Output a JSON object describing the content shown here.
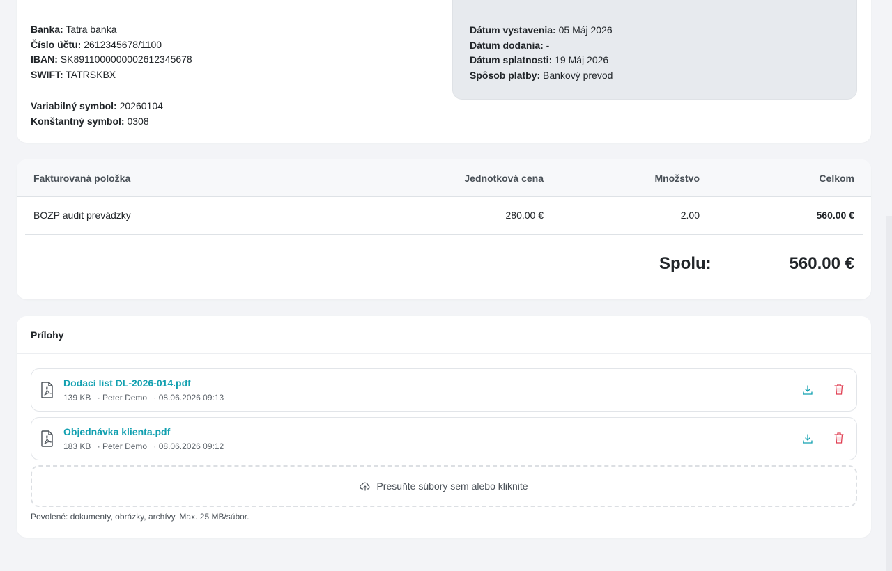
{
  "payment": {
    "bank_label": "Banka:",
    "bank_value": "Tatra banka",
    "account_label": "Číslo účtu:",
    "account_value": "2612345678/1100",
    "iban_label": "IBAN:",
    "iban_value": "SK8911000000002612345678",
    "swift_label": "SWIFT:",
    "swift_value": "TATRSKBX",
    "vs_label": "Variabilný symbol:",
    "vs_value": "20260104",
    "ks_label": "Konštantný symbol:",
    "ks_value": "0308"
  },
  "dates": {
    "issued_label": "Dátum vystavenia:",
    "issued_value": "05 Máj 2026",
    "delivered_label": "Dátum dodania:",
    "delivered_value": "-",
    "due_label": "Dátum splatnosti:",
    "due_value": "19 Máj 2026",
    "method_label": "Spôsob platby:",
    "method_value": "Bankový prevod"
  },
  "items": {
    "headers": {
      "item": "Fakturovaná položka",
      "unit_price": "Jednotková cena",
      "quantity": "Množstvo",
      "total": "Celkom"
    },
    "rows": [
      {
        "name": "BOZP audit prevádzky",
        "unit_price": "280.00 €",
        "quantity": "2.00",
        "total": "560.00 €"
      }
    ],
    "sum_label": "Spolu:",
    "sum_value": "560.00 €"
  },
  "attachments": {
    "title": "Prílohy",
    "files": [
      {
        "name": "Dodací list DL-2026-014.pdf",
        "size": "139 KB",
        "author": "· Peter Demo",
        "date": "· 08.06.2026 09:13"
      },
      {
        "name": "Objednávka klienta.pdf",
        "size": "183 KB",
        "author": "· Peter Demo",
        "date": "· 08.06.2026 09:12"
      }
    ],
    "dropzone_label": "Presuňte súbory sem alebo kliknite",
    "hint": "Povolené: dokumenty, obrázky, archívy. Max. 25 MB/súbor."
  },
  "colors": {
    "accent": "#12a0b0",
    "danger": "#e03e52",
    "page_bg": "#f3f4f7",
    "panel_bg": "#e7eaee"
  },
  "icons": [
    "pdf-file-icon",
    "download-icon",
    "trash-icon",
    "cloud-upload-icon"
  ]
}
